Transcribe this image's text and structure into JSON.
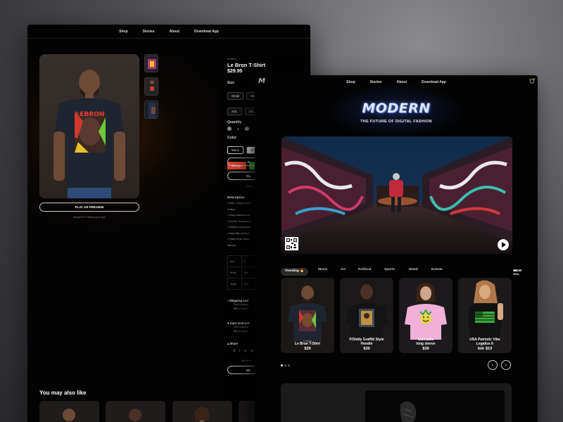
{
  "back": {
    "nav": [
      "Shop",
      "Stories",
      "About",
      "Download App"
    ],
    "product": {
      "colors_count": "6 colors",
      "title": "Le Bron T-Shirt",
      "price": "$29.95",
      "size_label": "Size",
      "sizes": [
        "Small",
        "Medi",
        "XXL",
        "3XL"
      ],
      "quantity_label": "Quantity",
      "quantity": "1",
      "color_label": "Color",
      "colors": [
        "Black",
        "White",
        "Orange",
        "Gre"
      ],
      "btn1": "A",
      "btn2": "Pa",
      "more": "More",
      "description_label": "Description",
      "bullets": [
        "• 2021, Super Soft T",
        "Cotton",
        "• Ivory colored blan",
        "• 5.9 Oz, Garment D",
        "• Printed neck label",
        "• Very little shrinka",
        "• Fabric Knit, Dyed,",
        "Mexico"
      ],
      "size_table": [
        [
          "Size",
          "S"
        ],
        [
          "Width",
          "18in"
        ],
        [
          "length",
          "27in"
        ]
      ],
      "shipping_label": "Shipping and",
      "shipping_text": [
        "Free shipping",
        "$50 or more!"
      ],
      "care_label": "Care Instructi",
      "care_text": [
        "Free shipping",
        "$50 or more!"
      ],
      "share_label": "Share",
      "be_first": "Be the fir",
      "write_btn": "Wr"
    },
    "preview_button": "PLAY AR PREVIEW",
    "model_note": "Model 6\"3\" Wearing M size",
    "also_like": "You may also like"
  },
  "front": {
    "nav": [
      "Shop",
      "Stories",
      "About",
      "Download App"
    ],
    "brand": "MODERN",
    "tagline": "THE FUTURE OF DIGITAL FASHION",
    "tabs": [
      "Trending 🔥",
      "Music",
      "Art",
      "Political",
      "Sports",
      "Weed",
      "Events"
    ],
    "view_all": "VIEW ALL",
    "cards": [
      {
        "colors": "6 colors",
        "name1": "Le Bron T-Shirt",
        "name2": "",
        "price": "$29",
        "old_price": ""
      },
      {
        "colors": "",
        "name1": "P.Diddy Graffiti Style",
        "name2": "Hoodie",
        "price": "$39",
        "old_price": ""
      },
      {
        "colors": "",
        "name1": "Cannabis",
        "name2": "long sleeve",
        "price": "$39",
        "old_price": ""
      },
      {
        "colors": "",
        "name1": "USA Patriotic Vibe",
        "name2": "Legalize It",
        "price": "$19",
        "old_price": "$29"
      }
    ]
  },
  "colors": {
    "accent_red": "#e2362a",
    "accent_green": "#3aa83a",
    "orange_chip": "#e0402d",
    "background": "#030303"
  }
}
